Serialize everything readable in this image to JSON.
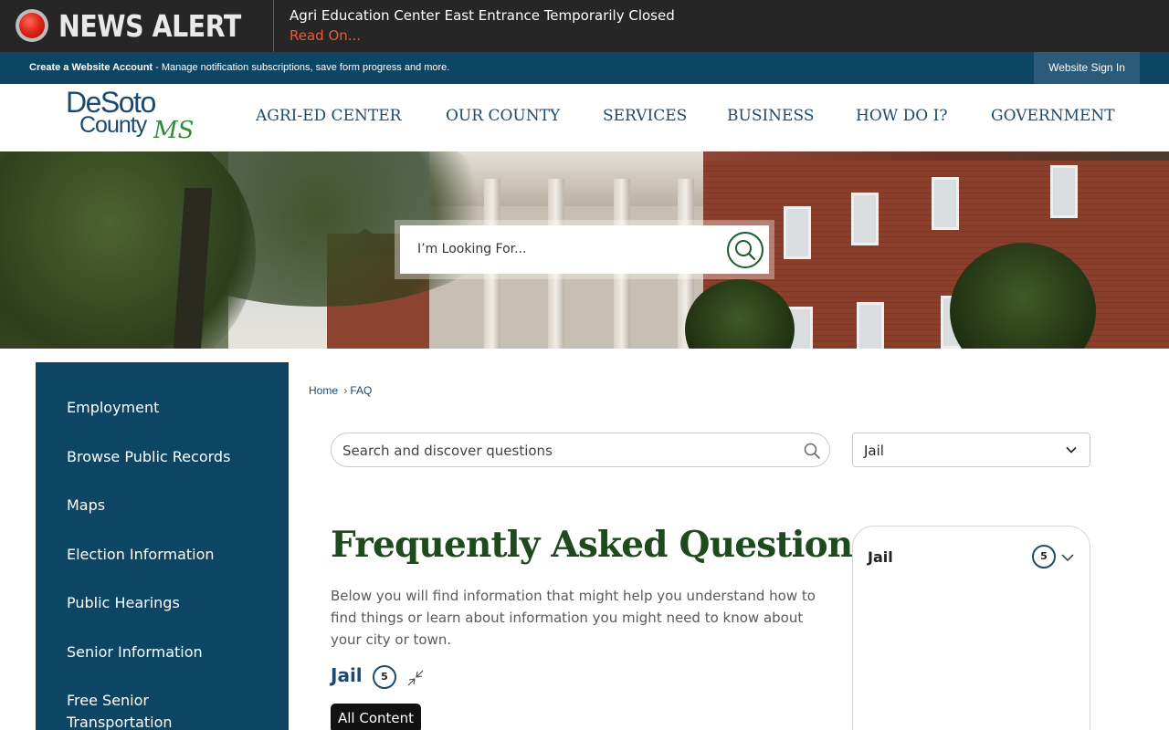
{
  "alert": {
    "title": "NEWS ALERT",
    "message": "Agri Education Center East Entrance Temporarily Closed",
    "link": "Read On..."
  },
  "account_bar": {
    "create_label": "Create a Website Account",
    "description": " - Manage notification subscriptions, save form progress and more.",
    "sign_in": "Website Sign In"
  },
  "logo": {
    "line1": "DeSoto",
    "line2": "County",
    "suffix": "MS"
  },
  "nav": [
    "AGRI-ED CENTER",
    "OUR COUNTY",
    "SERVICES",
    "BUSINESS",
    "HOW DO I?",
    "GOVERNMENT"
  ],
  "hero_search": {
    "placeholder": "I’m Looking For..."
  },
  "sidebar": {
    "items": [
      "Employment",
      "Browse Public Records",
      "Maps",
      "Election Information",
      "Public Hearings",
      "Senior Information",
      "Free Senior\nTransportation"
    ]
  },
  "breadcrumb": {
    "home": "Home",
    "separator": "›",
    "current": "FAQ"
  },
  "faq_search": {
    "placeholder": "Search and discover questions"
  },
  "category_select": {
    "value": "Jail"
  },
  "main": {
    "title": "Frequently Asked Questions",
    "description": "Below you will find information that might help you understand how to find things or learn about information you might need to know about your city or town.",
    "category_heading": "Jail",
    "category_count": "5",
    "all_content_label": "All Content"
  },
  "category_panel": {
    "label": "Jail",
    "count": "5"
  },
  "colors": {
    "alert_bg": "#262626",
    "alert_link": "#ef5a2f",
    "navy": "#0d4565",
    "nav_text": "#1b4a6e",
    "title_green": "#1e4a1e",
    "logo_green": "#2f8a3a"
  },
  "icons": [
    "alert-light-icon",
    "search-icon",
    "chevron-down-icon",
    "collapse-arrows-icon"
  ]
}
